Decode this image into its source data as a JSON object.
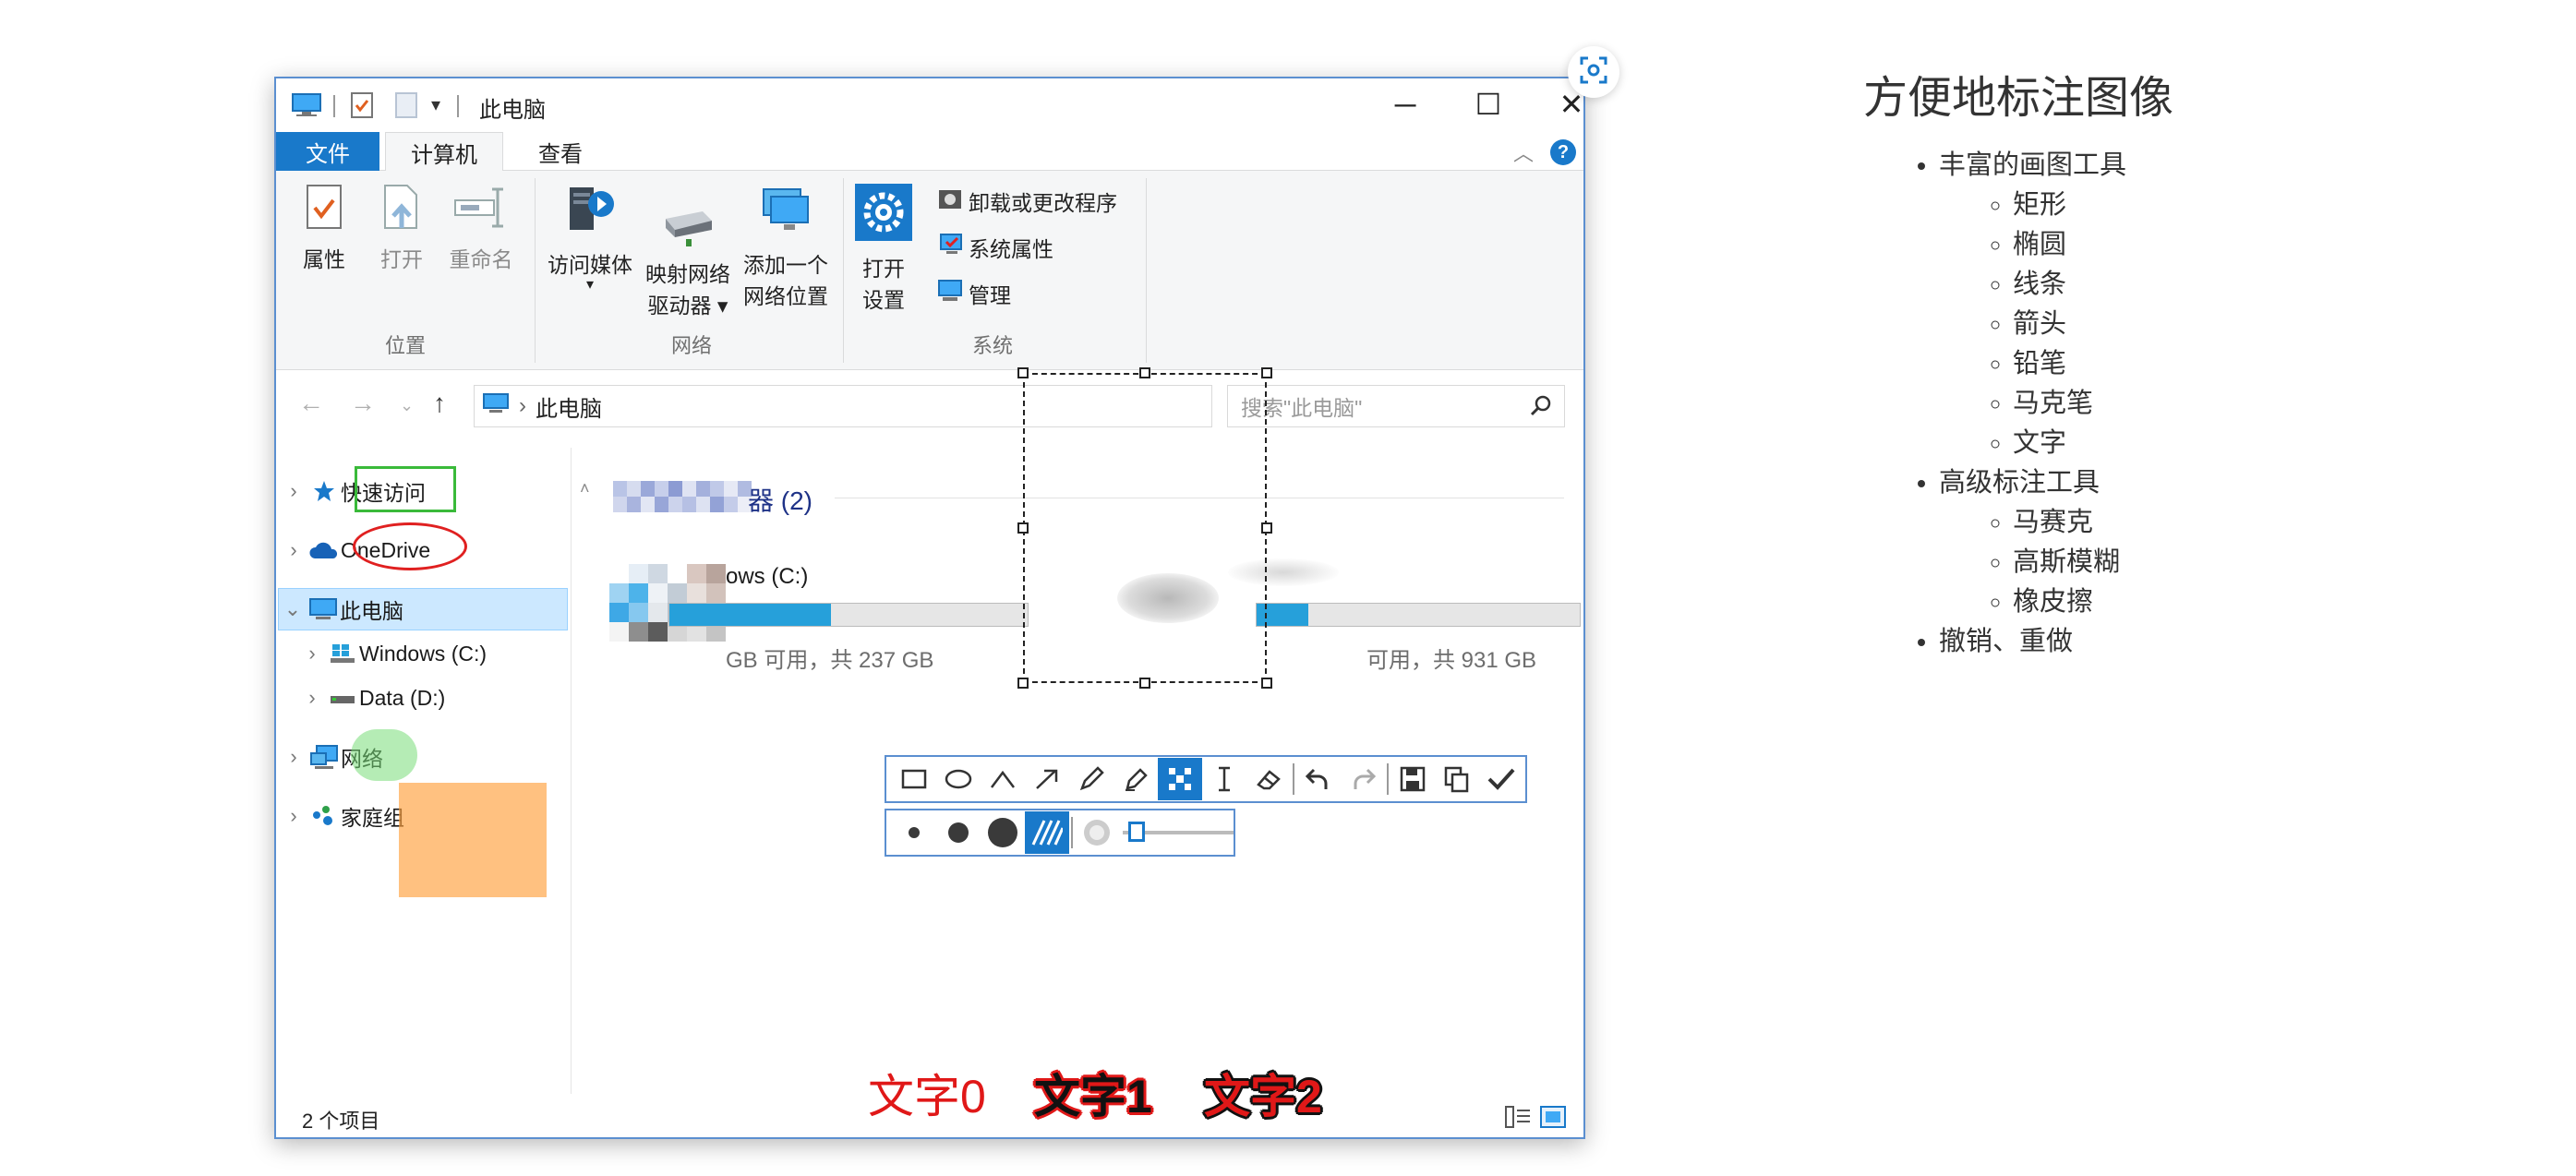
{
  "window": {
    "title": "此电脑",
    "controls": {
      "minimize": "─",
      "maximize": "☐",
      "close": "✕"
    }
  },
  "ribbon_tabs": [
    {
      "label": "文件"
    },
    {
      "label": "计算机"
    },
    {
      "label": "查看"
    }
  ],
  "ribbon": {
    "groups": [
      {
        "label": "位置",
        "buttons": [
          "属性",
          "打开",
          "重命名"
        ]
      },
      {
        "label": "网络",
        "buttons": [
          "访问媒体",
          "映射网络",
          "驱动器 ▾",
          "添加一个",
          "网络位置"
        ]
      },
      {
        "label": "系统",
        "buttons": [
          "打开",
          "设置"
        ],
        "small_buttons": [
          "卸载或更改程序",
          "系统属性",
          "管理"
        ]
      }
    ]
  },
  "address": {
    "path": "此电脑",
    "search_placeholder": "搜索\"此电脑\""
  },
  "nav_pane": [
    {
      "label": "快速访问"
    },
    {
      "label": "OneDrive"
    },
    {
      "label": "此电脑"
    },
    {
      "label": "Windows (C:)"
    },
    {
      "label": "Data (D:)"
    },
    {
      "label": "网络"
    },
    {
      "label": "家庭组"
    }
  ],
  "content": {
    "group_heading": "器 (2)",
    "drives": [
      {
        "label": "ows (C:)",
        "space": "GB 可用，共 237 GB",
        "fill": 0.45
      },
      {
        "label": "",
        "space": "可用，共 931 GB",
        "fill": 0.16
      }
    ]
  },
  "status": {
    "item_count": "2 个项目"
  },
  "annotation_text": [
    "文字0",
    "文字1",
    "文字2"
  ],
  "toolbar_tools": [
    "rectangle",
    "ellipse",
    "line",
    "arrow",
    "pencil",
    "marker",
    "mosaic",
    "text",
    "eraser",
    "undo",
    "redo",
    "save",
    "copy",
    "confirm"
  ],
  "colors": {
    "accent": "#1979ca",
    "annotation_red": "#e01818",
    "annotation_green": "#3aba3a",
    "marker_orange": "#ffa03c"
  },
  "doc": {
    "title": "方便地标注图像",
    "sections": [
      {
        "label": "丰富的画图工具",
        "items": [
          "矩形",
          "椭圆",
          "线条",
          "箭头",
          "铅笔",
          "马克笔",
          "文字"
        ]
      },
      {
        "label": "高级标注工具",
        "items": [
          "马赛克",
          "高斯模糊",
          "橡皮擦"
        ]
      },
      {
        "label": "撤销、重做",
        "items": []
      }
    ]
  }
}
